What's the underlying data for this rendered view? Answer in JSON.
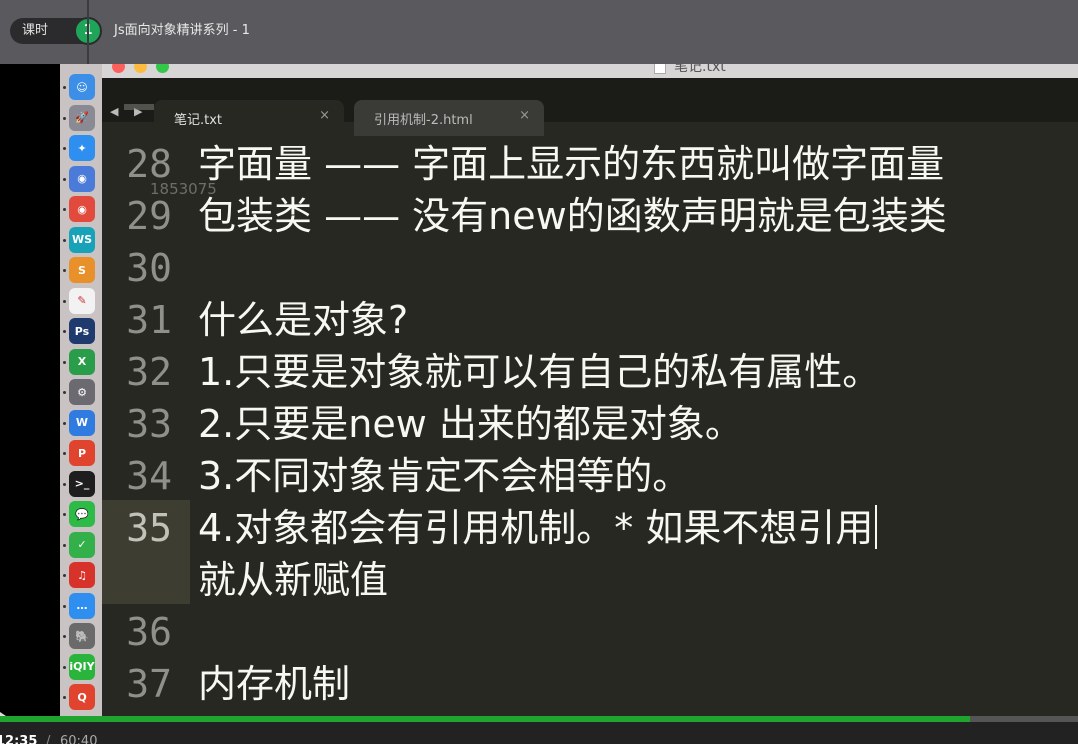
{
  "course": {
    "lesson_label": "课时",
    "lesson_number": "1",
    "lesson_title": "Js面向对象精讲系列 - 1"
  },
  "editor": {
    "window_title": "笔记.txt",
    "tabs": [
      {
        "label": "笔记.txt",
        "close": "×",
        "active": true
      },
      {
        "label": "引用机制-2.html",
        "close": "×",
        "active": false
      }
    ],
    "nav_arrows": "◀ ▶",
    "watermark": "1853075",
    "lines": [
      {
        "num": "28",
        "text": "字面量 —— 字面上显示的东西就叫做字面量"
      },
      {
        "num": "29",
        "text": "包装类 —— 没有new的函数声明就是包装类"
      },
      {
        "num": "30",
        "text": ""
      },
      {
        "num": "31",
        "text": "什么是对象?"
      },
      {
        "num": "32",
        "text": "1.只要是对象就可以有自己的私有属性。"
      },
      {
        "num": "33",
        "text": "2.只要是new 出来的都是对象。"
      },
      {
        "num": "34",
        "text": "3.不同对象肯定不会相等的。"
      },
      {
        "num": "35",
        "text": "4.对象都会有引用机制。* 如果不想引用",
        "wrap": "就从新赋值"
      },
      {
        "num": "36",
        "text": ""
      },
      {
        "num": "37",
        "text": "内存机制"
      }
    ]
  },
  "dock": {
    "icons": [
      {
        "name": "finder-icon",
        "glyph": "☺",
        "color": "#3d8ee6"
      },
      {
        "name": "launchpad-icon",
        "glyph": "🚀",
        "color": "#8a8a95"
      },
      {
        "name": "safari-icon",
        "glyph": "✦",
        "color": "#2f8ff0"
      },
      {
        "name": "chromium-icon",
        "glyph": "◉",
        "color": "#4b7bd8"
      },
      {
        "name": "chrome-icon",
        "glyph": "◉",
        "color": "#e14a3c"
      },
      {
        "name": "webstorm-icon",
        "glyph": "WS",
        "color": "#17a2b8"
      },
      {
        "name": "sublime-icon",
        "glyph": "S",
        "color": "#e8902a"
      },
      {
        "name": "notes-icon",
        "glyph": "✎",
        "color": "#f2f2f2"
      },
      {
        "name": "photoshop-icon",
        "glyph": "Ps",
        "color": "#1f3b6e"
      },
      {
        "name": "excel-icon",
        "glyph": "X",
        "color": "#2a9d4a"
      },
      {
        "name": "preferences-icon",
        "glyph": "⚙",
        "color": "#6a6a70"
      },
      {
        "name": "wps-icon",
        "glyph": "W",
        "color": "#2f7be0"
      },
      {
        "name": "wps-ppt-icon",
        "glyph": "P",
        "color": "#e0442f"
      },
      {
        "name": "terminal-icon",
        "glyph": ">_",
        "color": "#1e1e1e"
      },
      {
        "name": "wechat-icon",
        "glyph": "💬",
        "color": "#2dba47"
      },
      {
        "name": "app-yellow-icon",
        "glyph": "✓",
        "color": "#34b04a"
      },
      {
        "name": "netease-music-icon",
        "glyph": "♫",
        "color": "#d8332b"
      },
      {
        "name": "messages-icon",
        "glyph": "…",
        "color": "#2f8ff0"
      },
      {
        "name": "evernote-icon",
        "glyph": "🐘",
        "color": "#6a6a6a"
      },
      {
        "name": "iqiyi-icon",
        "glyph": "iQIY",
        "color": "#2ab43c"
      },
      {
        "name": "qq-icon",
        "glyph": "Q",
        "color": "#e0442f"
      }
    ]
  },
  "player": {
    "current_time": "12:35",
    "separator": "/",
    "total_time": "60:40",
    "progress": 0.9
  }
}
